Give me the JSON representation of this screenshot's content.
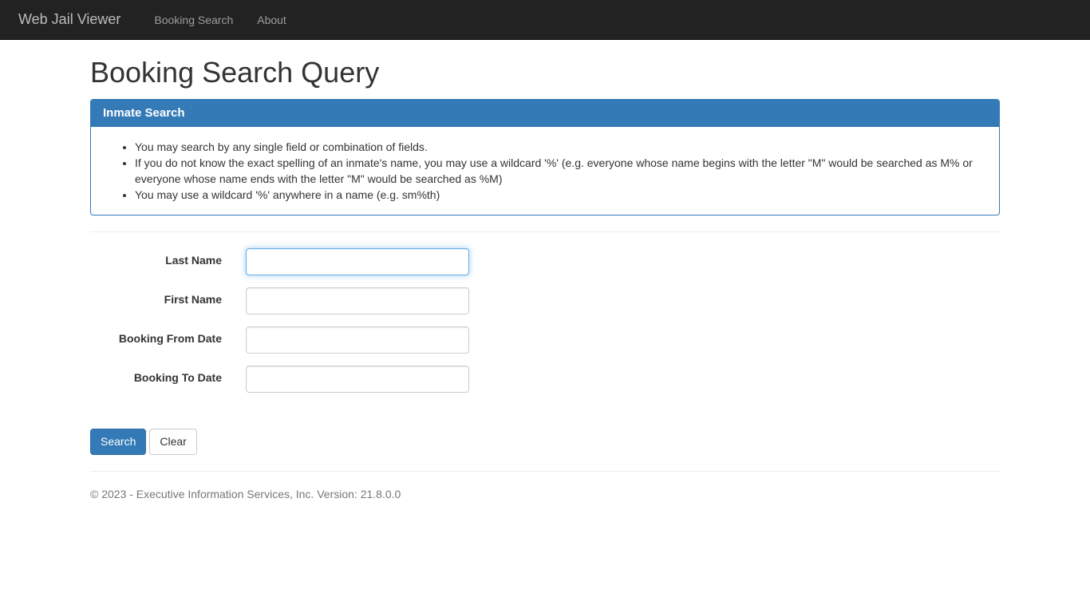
{
  "navbar": {
    "brand": "Web Jail Viewer",
    "items": [
      {
        "label": "Booking Search"
      },
      {
        "label": "About"
      }
    ]
  },
  "page": {
    "title": "Booking Search Query"
  },
  "panel": {
    "heading": "Inmate Search",
    "instructions": [
      "You may search by any single field or combination of fields.",
      "If you do not know the exact spelling of an inmate's name, you may use a wildcard '%' (e.g. everyone whose name begins with the letter \"M\" would be searched as M% or everyone whose name ends with the letter \"M\" would be searched as %M)",
      "You may use a wildcard '%' anywhere in a name (e.g. sm%th)"
    ]
  },
  "form": {
    "fields": [
      {
        "label": "Last Name",
        "value": "",
        "focused": true
      },
      {
        "label": "First Name",
        "value": "",
        "focused": false
      },
      {
        "label": "Booking From Date",
        "value": "",
        "focused": false
      },
      {
        "label": "Booking To Date",
        "value": "",
        "focused": false
      }
    ],
    "search_label": "Search",
    "clear_label": "Clear"
  },
  "footer": {
    "text": "© 2023 - Executive Information Services, Inc. Version: 21.8.0.0"
  },
  "colors": {
    "accent": "#337ab7",
    "navbar_bg": "#222222",
    "focus_border": "#66afe9"
  }
}
